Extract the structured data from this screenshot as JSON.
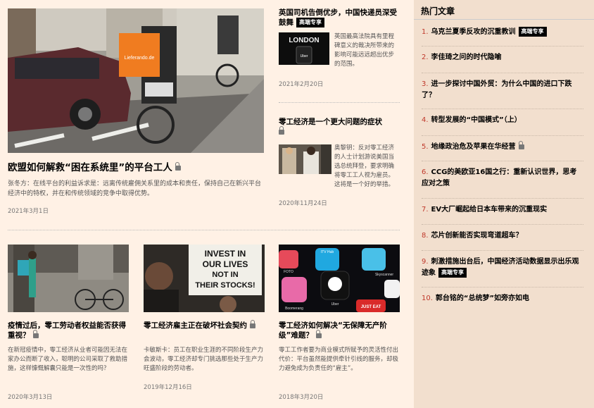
{
  "main": {
    "hero": {
      "title": "欧盟如何解救“困在系统里”的平台工人",
      "summary": "张冬方：在线平台的利益诉求是：远离传统雇佣关系里的成本和责任，保持自己在新兴平台经济中的特权，并在和传统领域的竞争中取得优势。",
      "date": "2021年3月1日",
      "bag_text": "Lieferando.de"
    },
    "side_articles": [
      {
        "title": "英国司机告倒优步，中国快递员深受鼓舞",
        "badge": "高端专享",
        "summary": "英国最高法院具有里程碑意义的裁决所带来的影响可能远远超出优步的范围。",
        "date": "2021年2月20日",
        "image_text": "LONDON",
        "image_subtext": "Uber"
      },
      {
        "title": "零工经济是一个更大问题的症状",
        "summary": "奥黎钥：反对零工经济的人士计划游说美国当选总统拜登，要求明确将零工工人视为雇员。这将是一个好的举措。",
        "date": "2020年11月24日"
      }
    ],
    "bottom_articles": [
      {
        "title": "疫情过后，零工劳动者权益能否获得重视？",
        "summary": "在新冠疫情中，零工经济从业者可能因无法在家办公而断了收入，聪明的公司采取了救助措施，这样慷慨解囊只能是一次性的吗？",
        "date": "2020年3月13日"
      },
      {
        "title": "零工经济雇主正在破坏社会契约",
        "summary": "卡敏斯卡：员工在职业生涯的不同阶段生产力会波动，零工经济却专门挑选那些处于生产力旺盛阶段的劳动者。",
        "date": "2019年12月16日",
        "sign_lines": [
          "INVEST IN",
          "OUR LIVES",
          "NOT IN",
          "THEIR STOCKS!"
        ]
      },
      {
        "title": "零工经济如何解决“无保障无产阶级”难题？",
        "summary": "零工工作者要为商业模式所赋予的灵活性付出代价：平台虽然能提供牵针引线的服务，却极力避免成为负责任的“雇主”。",
        "date": "2018年3月20日",
        "app_labels": [
          "FOTO",
          "ITV Hub",
          "Uber",
          "Skyscanner",
          "Boomerang",
          "JUST EAT"
        ]
      }
    ]
  },
  "sidebar": {
    "heading": "热门文章",
    "badge": "高端专享",
    "items": [
      {
        "num": "1.",
        "title": "乌克兰夏季反攻的沉重教训",
        "badge": true
      },
      {
        "num": "2.",
        "title": "李佳琦之问的时代隐喻"
      },
      {
        "num": "3.",
        "title": "进一步探讨中国外贸：为什么中国的进口下跌了？"
      },
      {
        "num": "4.",
        "title": "转型发展的“中国模式”（上）"
      },
      {
        "num": "5.",
        "title": "地缘政治危及苹果在华经营",
        "lock": true
      },
      {
        "num": "6.",
        "title": "CCG的美欧亚16国之行：重新认识世界，思考应对之策"
      },
      {
        "num": "7.",
        "title": "EV大厂崛起给日本车带来的沉重现实"
      },
      {
        "num": "8.",
        "title": "芯片创新能否实现弯道超车？"
      },
      {
        "num": "9.",
        "title": "刺激措施出台后，中国经济活动数据显示出乐观迹象",
        "badge": true
      },
      {
        "num": "10.",
        "title": "郭台铭的“总统梦”如旁亦如电"
      }
    ]
  },
  "colors": {
    "page_bg": "#fff1e5",
    "sidebar_bg": "#f2dfce",
    "number_red": "#c0392b",
    "badge_bg": "#000000"
  }
}
